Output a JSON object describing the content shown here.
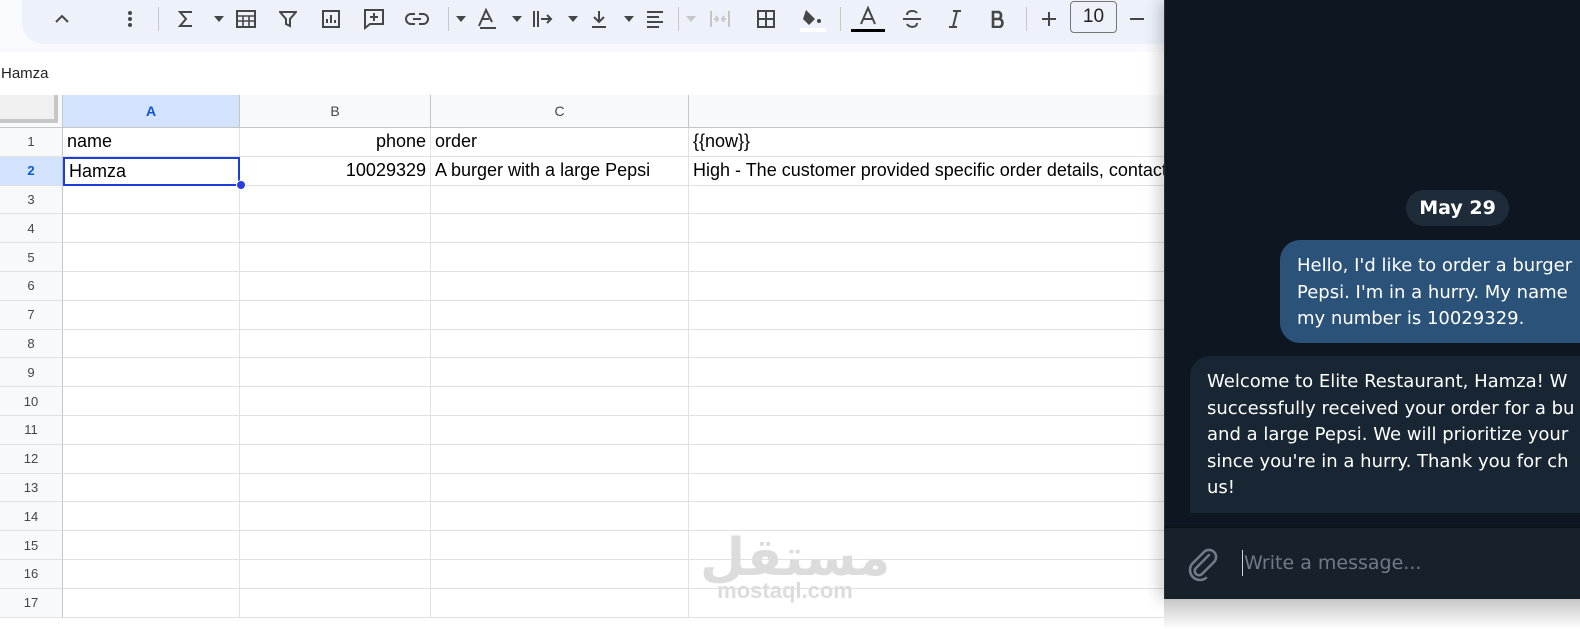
{
  "spreadsheet": {
    "name_box": "Hamza",
    "font_size": "10",
    "columns": [
      "A",
      "B",
      "C"
    ],
    "selected_column": "A",
    "rows": [
      "1",
      "2",
      "3",
      "4",
      "5",
      "6",
      "7",
      "8",
      "9",
      "10",
      "11",
      "12",
      "13",
      "14",
      "15",
      "16",
      "17"
    ],
    "selected_row": "2",
    "cells": {
      "r1": {
        "a": "name",
        "b": "phone",
        "c": "order",
        "d": "{{now}}"
      },
      "r2": {
        "a": "Hamza",
        "b": "10029329",
        "c": "A burger with a large Pepsi",
        "d": "High - The customer provided specific order details, contact"
      }
    }
  },
  "watermark": {
    "arabic": "مستقل",
    "latin": "mostaql.com"
  },
  "chat": {
    "date": "May 29",
    "outgoing_message": "Hello, I'd like to order a burger\nPepsi. I'm in a hurry. My name\nmy number is 10029329.",
    "incoming_message": "Welcome to Elite Restaurant, Hamza! W\nsuccessfully received your order for a bu\nand a large Pepsi. We will prioritize your\nsince you're in a hurry. Thank you for ch\nus!",
    "composer_placeholder": "Write a message..."
  },
  "colors": {
    "chat_background": "#0e1621",
    "outgoing_bubble": "#2b5278",
    "incoming_bubble": "#182533",
    "selection_blue": "#1a3ed6",
    "header_selected": "#d3e3fd"
  },
  "icons": [
    "collapse-chevron-up-icon",
    "more-vert-icon",
    "sigma-icon",
    "table-icon",
    "filter-icon",
    "chart-icon",
    "add-comment-icon",
    "link-icon",
    "text-color-icon",
    "text-direction-icon",
    "vertical-align-icon",
    "horizontal-align-icon",
    "merge-cells-icon",
    "borders-icon",
    "fill-color-icon",
    "strikethrough-icon",
    "italic-icon",
    "bold-icon",
    "plus-icon",
    "minus-icon",
    "paperclip-icon"
  ]
}
